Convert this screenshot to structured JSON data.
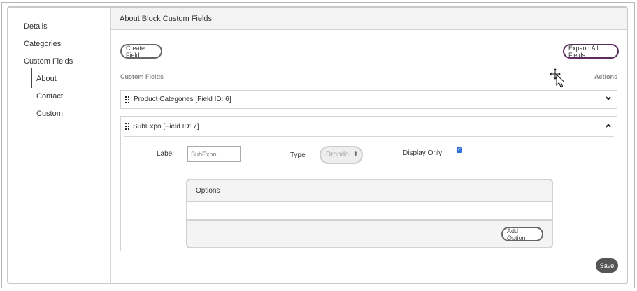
{
  "sidebar": {
    "items": [
      {
        "label": "Details"
      },
      {
        "label": "Categories"
      },
      {
        "label": "Custom Fields"
      }
    ],
    "subitems": [
      {
        "label": "About",
        "active": true
      },
      {
        "label": "Contact"
      },
      {
        "label": "Custom"
      }
    ]
  },
  "header": {
    "title": "About Block Custom Fields"
  },
  "toolbar": {
    "create_label": "Create Field",
    "expand_label": "Expand All Fields"
  },
  "columns": {
    "left": "Custom Fields",
    "right": "Actions"
  },
  "fields": [
    {
      "title": "Product Categories [Field ID: 6]",
      "expanded": false,
      "chevron": "chevron-down-icon"
    },
    {
      "title": "SubExpo [Field ID: 7]",
      "expanded": true,
      "chevron": "chevron-up-icon"
    }
  ],
  "field_form": {
    "label_text": "Label",
    "label_value": "SubExpo",
    "type_text": "Type",
    "type_value": "Dropdo",
    "display_only_text": "Display Only",
    "display_only_checked": true
  },
  "options": {
    "title": "Options",
    "add_label": "Add Option"
  },
  "footer": {
    "save_label": "Save"
  },
  "colors": {
    "accent": "#5a2c60",
    "checkbox": "#2f6fd6",
    "save": "#555555"
  }
}
